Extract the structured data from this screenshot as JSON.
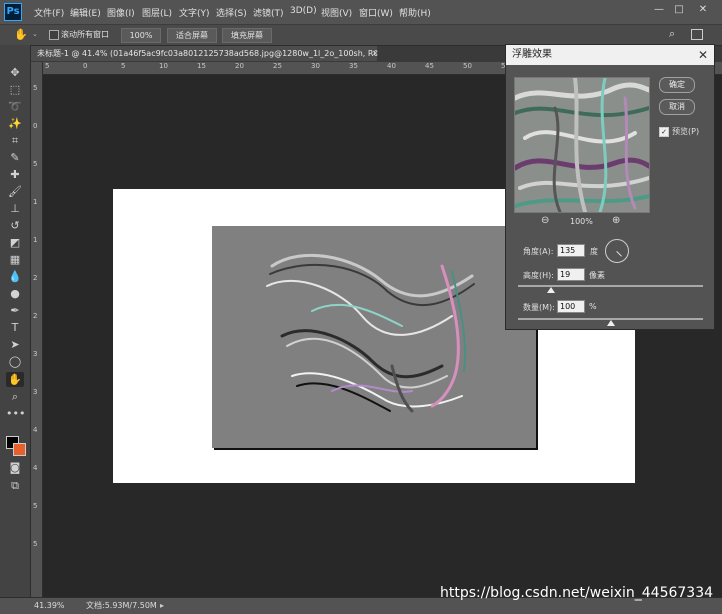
{
  "app": {
    "logo": "Ps"
  },
  "menu": [
    "文件(F)",
    "编辑(E)",
    "图像(I)",
    "图层(L)",
    "文字(Y)",
    "选择(S)",
    "滤镜(T)",
    "3D(D)",
    "视图(V)",
    "窗口(W)",
    "帮助(H)"
  ],
  "window_controls": {
    "minimize": "—",
    "restore": "□",
    "close": "✕"
  },
  "options_bar": {
    "scroll_all_label": "滚动所有窗口",
    "zoom_value": "100%",
    "fit_screen": "适合屏幕",
    "fill_screen": "填充屏幕"
  },
  "document_tab": {
    "title": "未标题-1 @ 41.4% (01a46f5ac9fc03a8012125738ad568.jpg@1280w_1l_2o_100sh, RGB/8#) *",
    "close": "✕"
  },
  "ruler_top_labels": [
    "5",
    "0",
    "5",
    "10",
    "15",
    "20",
    "25",
    "30",
    "35",
    "40",
    "45",
    "50",
    "55",
    "60"
  ],
  "ruler_left_labels": [
    "5",
    "0",
    "5",
    "1",
    "1",
    "2",
    "2",
    "3",
    "3",
    "4",
    "4",
    "5",
    "5"
  ],
  "status_bar": {
    "zoom": "41.39%",
    "doc_info": "文档:5.93M/7.50M"
  },
  "watermark": "https://blog.csdn.net/weixin_44567334",
  "dialog": {
    "title": "浮雕效果",
    "close": "✕",
    "ok": "确定",
    "cancel": "取消",
    "preview_label": "预览(P)",
    "preview_checked": true,
    "zoom_out_icon": "⊖",
    "zoom_level": "100%",
    "zoom_in_icon": "⊕",
    "angle_label": "角度(A):",
    "angle_value": "135",
    "angle_unit": "度",
    "height_label": "高度(H):",
    "height_value": "19",
    "height_unit": "像素",
    "height_slider_fraction": 0.18,
    "amount_label": "数量(M):",
    "amount_value": "100",
    "amount_unit": "%",
    "amount_slider_fraction": 0.5
  }
}
